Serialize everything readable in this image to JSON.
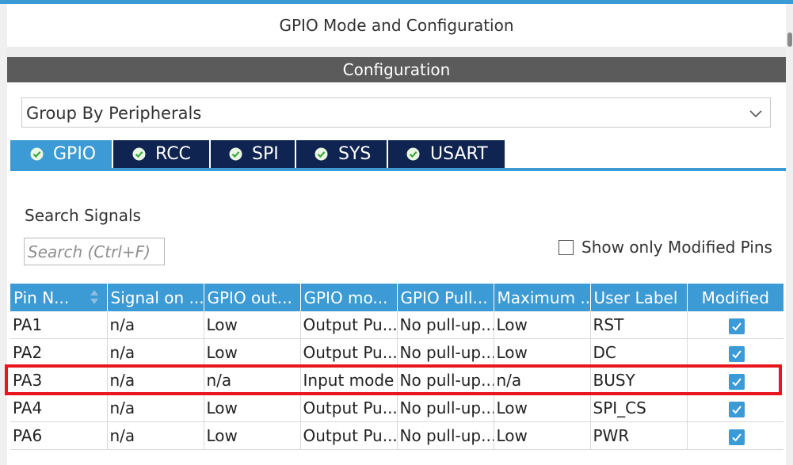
{
  "window": {
    "title": "GPIO Mode and Configuration"
  },
  "configuration": {
    "header": "Configuration",
    "group_by": "Group By Peripherals"
  },
  "tabs": [
    {
      "label": "GPIO",
      "active": true,
      "icon": "check-circle-icon"
    },
    {
      "label": "RCC",
      "active": false,
      "icon": "check-circle-icon"
    },
    {
      "label": "SPI",
      "active": false,
      "icon": "check-circle-icon"
    },
    {
      "label": "SYS",
      "active": false,
      "icon": "check-circle-icon"
    },
    {
      "label": "USART",
      "active": false,
      "icon": "check-circle-icon"
    }
  ],
  "search": {
    "label": "Search Signals",
    "placeholder": "Search (Ctrl+F)",
    "value": ""
  },
  "show_modified": {
    "label": "Show only Modified Pins",
    "checked": false
  },
  "table": {
    "columns": [
      "Pin N...",
      "Signal on ...",
      "GPIO out...",
      "GPIO mo...",
      "GPIO Pull...",
      "Maximum ...",
      "User Label",
      "Modified"
    ],
    "rows": [
      {
        "pin": "PA1",
        "signal": "n/a",
        "output": "Low",
        "mode": "Output Pu...",
        "pull": "No pull-up...",
        "maximum": "Low",
        "user_label": "RST",
        "modified": true
      },
      {
        "pin": "PA2",
        "signal": "n/a",
        "output": "Low",
        "mode": "Output Pu...",
        "pull": "No pull-up...",
        "maximum": "Low",
        "user_label": "DC",
        "modified": true
      },
      {
        "pin": "PA3",
        "signal": "n/a",
        "output": "n/a",
        "mode": "Input mode",
        "pull": "No pull-up...",
        "maximum": "n/a",
        "user_label": "BUSY",
        "modified": true
      },
      {
        "pin": "PA4",
        "signal": "n/a",
        "output": "Low",
        "mode": "Output Pu...",
        "pull": "No pull-up...",
        "maximum": "Low",
        "user_label": "SPI_CS",
        "modified": true
      },
      {
        "pin": "PA6",
        "signal": "n/a",
        "output": "Low",
        "mode": "Output Pu...",
        "pull": "No pull-up...",
        "maximum": "Low",
        "user_label": "PWR",
        "modified": true
      }
    ],
    "highlighted_row": "PA3"
  },
  "colors": {
    "accent": "#3c9ad4",
    "tab_inactive": "#0f2450",
    "header_bar": "#5b5b5b",
    "highlight": "#e8161d"
  }
}
